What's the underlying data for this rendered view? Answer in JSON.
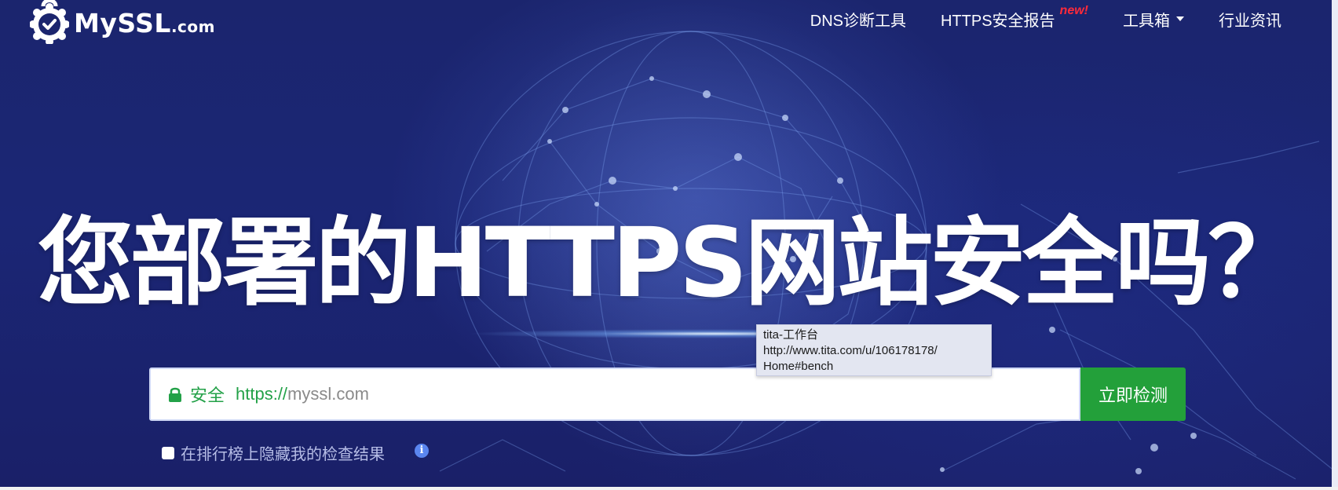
{
  "header": {
    "logo": {
      "main": "MySSL",
      "suffix": ".com"
    },
    "nav": [
      {
        "label": "DNS诊断工具"
      },
      {
        "label": "HTTPS安全报告",
        "badge": "new!"
      },
      {
        "label": "工具箱",
        "has_dropdown": true
      },
      {
        "label": "行业资讯"
      }
    ]
  },
  "hero": {
    "headline": "您部署的HTTPS网站安全吗？"
  },
  "search": {
    "secure_label": "安全",
    "scheme": "https://",
    "placeholder": "myssl.com",
    "button_label": "立即检测"
  },
  "options": {
    "hide_result_label": "在排行榜上隐藏我的检查结果",
    "info_icon": "info-icon"
  },
  "tooltip": {
    "line1": "tita-工作台",
    "line2": "http://www.tita.com/u/106178178/",
    "line3": "Home#bench"
  },
  "colors": {
    "background": "#1b256e",
    "accent_green": "#23a03a",
    "new_badge": "#ff2a3a"
  }
}
